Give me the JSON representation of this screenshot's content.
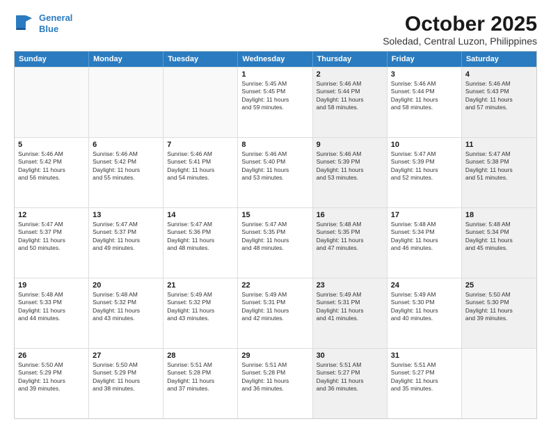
{
  "logo": {
    "line1": "General",
    "line2": "Blue"
  },
  "title": "October 2025",
  "subtitle": "Soledad, Central Luzon, Philippines",
  "weekdays": [
    "Sunday",
    "Monday",
    "Tuesday",
    "Wednesday",
    "Thursday",
    "Friday",
    "Saturday"
  ],
  "rows": [
    [
      {
        "day": "",
        "lines": [],
        "shaded": false,
        "empty": true
      },
      {
        "day": "",
        "lines": [],
        "shaded": false,
        "empty": true
      },
      {
        "day": "",
        "lines": [],
        "shaded": false,
        "empty": true
      },
      {
        "day": "1",
        "lines": [
          "Sunrise: 5:45 AM",
          "Sunset: 5:45 PM",
          "Daylight: 11 hours",
          "and 59 minutes."
        ],
        "shaded": false,
        "empty": false
      },
      {
        "day": "2",
        "lines": [
          "Sunrise: 5:46 AM",
          "Sunset: 5:44 PM",
          "Daylight: 11 hours",
          "and 58 minutes."
        ],
        "shaded": true,
        "empty": false
      },
      {
        "day": "3",
        "lines": [
          "Sunrise: 5:46 AM",
          "Sunset: 5:44 PM",
          "Daylight: 11 hours",
          "and 58 minutes."
        ],
        "shaded": false,
        "empty": false
      },
      {
        "day": "4",
        "lines": [
          "Sunrise: 5:46 AM",
          "Sunset: 5:43 PM",
          "Daylight: 11 hours",
          "and 57 minutes."
        ],
        "shaded": true,
        "empty": false
      }
    ],
    [
      {
        "day": "5",
        "lines": [
          "Sunrise: 5:46 AM",
          "Sunset: 5:42 PM",
          "Daylight: 11 hours",
          "and 56 minutes."
        ],
        "shaded": false,
        "empty": false
      },
      {
        "day": "6",
        "lines": [
          "Sunrise: 5:46 AM",
          "Sunset: 5:42 PM",
          "Daylight: 11 hours",
          "and 55 minutes."
        ],
        "shaded": false,
        "empty": false
      },
      {
        "day": "7",
        "lines": [
          "Sunrise: 5:46 AM",
          "Sunset: 5:41 PM",
          "Daylight: 11 hours",
          "and 54 minutes."
        ],
        "shaded": false,
        "empty": false
      },
      {
        "day": "8",
        "lines": [
          "Sunrise: 5:46 AM",
          "Sunset: 5:40 PM",
          "Daylight: 11 hours",
          "and 53 minutes."
        ],
        "shaded": false,
        "empty": false
      },
      {
        "day": "9",
        "lines": [
          "Sunrise: 5:46 AM",
          "Sunset: 5:39 PM",
          "Daylight: 11 hours",
          "and 53 minutes."
        ],
        "shaded": true,
        "empty": false
      },
      {
        "day": "10",
        "lines": [
          "Sunrise: 5:47 AM",
          "Sunset: 5:39 PM",
          "Daylight: 11 hours",
          "and 52 minutes."
        ],
        "shaded": false,
        "empty": false
      },
      {
        "day": "11",
        "lines": [
          "Sunrise: 5:47 AM",
          "Sunset: 5:38 PM",
          "Daylight: 11 hours",
          "and 51 minutes."
        ],
        "shaded": true,
        "empty": false
      }
    ],
    [
      {
        "day": "12",
        "lines": [
          "Sunrise: 5:47 AM",
          "Sunset: 5:37 PM",
          "Daylight: 11 hours",
          "and 50 minutes."
        ],
        "shaded": false,
        "empty": false
      },
      {
        "day": "13",
        "lines": [
          "Sunrise: 5:47 AM",
          "Sunset: 5:37 PM",
          "Daylight: 11 hours",
          "and 49 minutes."
        ],
        "shaded": false,
        "empty": false
      },
      {
        "day": "14",
        "lines": [
          "Sunrise: 5:47 AM",
          "Sunset: 5:36 PM",
          "Daylight: 11 hours",
          "and 48 minutes."
        ],
        "shaded": false,
        "empty": false
      },
      {
        "day": "15",
        "lines": [
          "Sunrise: 5:47 AM",
          "Sunset: 5:35 PM",
          "Daylight: 11 hours",
          "and 48 minutes."
        ],
        "shaded": false,
        "empty": false
      },
      {
        "day": "16",
        "lines": [
          "Sunrise: 5:48 AM",
          "Sunset: 5:35 PM",
          "Daylight: 11 hours",
          "and 47 minutes."
        ],
        "shaded": true,
        "empty": false
      },
      {
        "day": "17",
        "lines": [
          "Sunrise: 5:48 AM",
          "Sunset: 5:34 PM",
          "Daylight: 11 hours",
          "and 46 minutes."
        ],
        "shaded": false,
        "empty": false
      },
      {
        "day": "18",
        "lines": [
          "Sunrise: 5:48 AM",
          "Sunset: 5:34 PM",
          "Daylight: 11 hours",
          "and 45 minutes."
        ],
        "shaded": true,
        "empty": false
      }
    ],
    [
      {
        "day": "19",
        "lines": [
          "Sunrise: 5:48 AM",
          "Sunset: 5:33 PM",
          "Daylight: 11 hours",
          "and 44 minutes."
        ],
        "shaded": false,
        "empty": false
      },
      {
        "day": "20",
        "lines": [
          "Sunrise: 5:48 AM",
          "Sunset: 5:32 PM",
          "Daylight: 11 hours",
          "and 43 minutes."
        ],
        "shaded": false,
        "empty": false
      },
      {
        "day": "21",
        "lines": [
          "Sunrise: 5:49 AM",
          "Sunset: 5:32 PM",
          "Daylight: 11 hours",
          "and 43 minutes."
        ],
        "shaded": false,
        "empty": false
      },
      {
        "day": "22",
        "lines": [
          "Sunrise: 5:49 AM",
          "Sunset: 5:31 PM",
          "Daylight: 11 hours",
          "and 42 minutes."
        ],
        "shaded": false,
        "empty": false
      },
      {
        "day": "23",
        "lines": [
          "Sunrise: 5:49 AM",
          "Sunset: 5:31 PM",
          "Daylight: 11 hours",
          "and 41 minutes."
        ],
        "shaded": true,
        "empty": false
      },
      {
        "day": "24",
        "lines": [
          "Sunrise: 5:49 AM",
          "Sunset: 5:30 PM",
          "Daylight: 11 hours",
          "and 40 minutes."
        ],
        "shaded": false,
        "empty": false
      },
      {
        "day": "25",
        "lines": [
          "Sunrise: 5:50 AM",
          "Sunset: 5:30 PM",
          "Daylight: 11 hours",
          "and 39 minutes."
        ],
        "shaded": true,
        "empty": false
      }
    ],
    [
      {
        "day": "26",
        "lines": [
          "Sunrise: 5:50 AM",
          "Sunset: 5:29 PM",
          "Daylight: 11 hours",
          "and 39 minutes."
        ],
        "shaded": false,
        "empty": false
      },
      {
        "day": "27",
        "lines": [
          "Sunrise: 5:50 AM",
          "Sunset: 5:29 PM",
          "Daylight: 11 hours",
          "and 38 minutes."
        ],
        "shaded": false,
        "empty": false
      },
      {
        "day": "28",
        "lines": [
          "Sunrise: 5:51 AM",
          "Sunset: 5:28 PM",
          "Daylight: 11 hours",
          "and 37 minutes."
        ],
        "shaded": false,
        "empty": false
      },
      {
        "day": "29",
        "lines": [
          "Sunrise: 5:51 AM",
          "Sunset: 5:28 PM",
          "Daylight: 11 hours",
          "and 36 minutes."
        ],
        "shaded": false,
        "empty": false
      },
      {
        "day": "30",
        "lines": [
          "Sunrise: 5:51 AM",
          "Sunset: 5:27 PM",
          "Daylight: 11 hours",
          "and 36 minutes."
        ],
        "shaded": true,
        "empty": false
      },
      {
        "day": "31",
        "lines": [
          "Sunrise: 5:51 AM",
          "Sunset: 5:27 PM",
          "Daylight: 11 hours",
          "and 35 minutes."
        ],
        "shaded": false,
        "empty": false
      },
      {
        "day": "",
        "lines": [],
        "shaded": true,
        "empty": true
      }
    ]
  ]
}
